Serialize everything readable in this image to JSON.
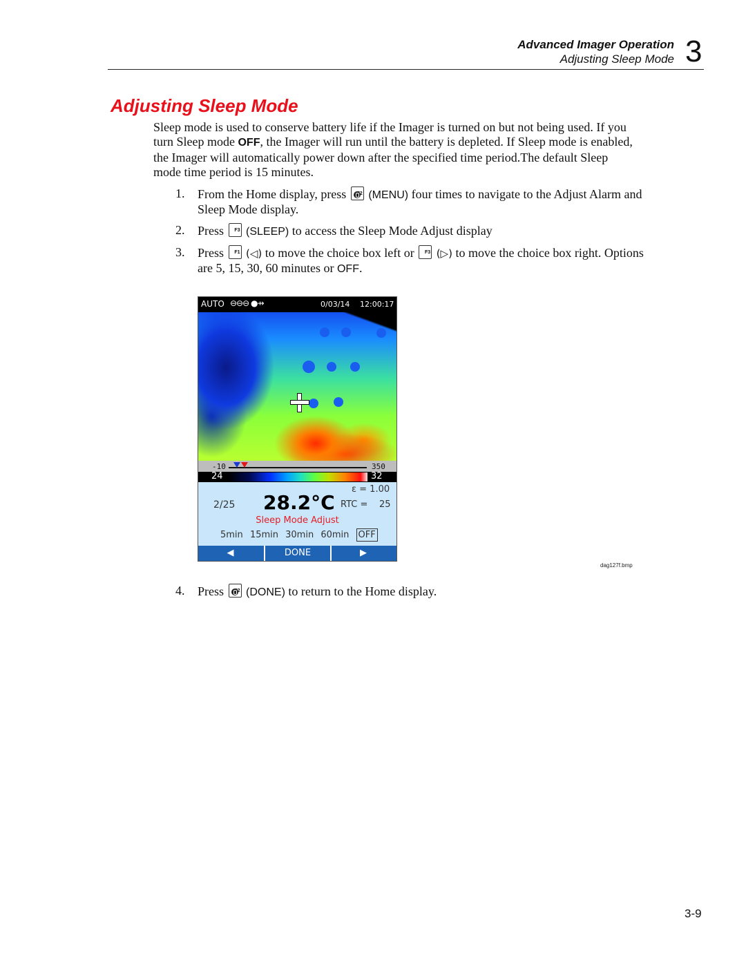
{
  "header": {
    "chapter_title": "Advanced Imager Operation",
    "section_title": "Adjusting Sleep Mode",
    "chapter_number": "3"
  },
  "section": {
    "title": "Adjusting Sleep Mode",
    "intro": {
      "part1": "Sleep mode is used to conserve battery life if the Imager is turned on but not being used. If you turn Sleep mode ",
      "bold": "OFF",
      "part2": ", the Imager will run until the battery is depleted. If Sleep mode is enabled, the Imager will automatically power down after the specified time period.The default Sleep mode time period is 15 minutes."
    }
  },
  "steps": [
    {
      "num": "1.",
      "a": "From the Home display, press ",
      "key": "F2",
      "b": " (MENU) four times to navigate to the Adjust Alarm and Sleep Mode display.",
      "key_label": "(MENU)"
    },
    {
      "num": "2.",
      "a": "Press ",
      "key": "F3",
      "key_label": "(SLEEP)",
      "b": " to access the Sleep Mode Adjust display"
    },
    {
      "num": "3.",
      "a": "Press ",
      "key1": "F1",
      "left": "(◁)",
      "mid": " to move the choice box left or ",
      "key2": "F3",
      "right": "(▷)",
      "b": " to move the choice box right. Options are 5, 15, 30, 60 minutes or ",
      "off": "OFF",
      "end": "."
    },
    {
      "num": "4.",
      "a": "Press ",
      "key": "F2",
      "key_label": "(DONE)",
      "b": " to return to the Home display."
    }
  ],
  "screen": {
    "mode": "AUTO",
    "status_icons": "⊖⊖⊖ ●⇸",
    "date": "0/03/14",
    "time": "12:00:17",
    "scale_low": "-10",
    "scale_high": "350",
    "palette_low": "24",
    "palette_high": "32",
    "emissivity": "ε = 1.00",
    "image_count": "2/25",
    "temperature": "28.2°C",
    "rtc_label": "RTC =",
    "rtc_value": "25",
    "menu_title": "Sleep Mode Adjust",
    "options": [
      "5min",
      "15min",
      "30min",
      "60min"
    ],
    "selected_option": "OFF",
    "softkeys": {
      "left": "◀",
      "center": "DONE",
      "right": "▶"
    },
    "colors": {
      "title": "#e81c24",
      "softkey_bar": "#1f63b4",
      "panel": "#c9e6fb"
    }
  },
  "figure_caption": "dag127f.bmp",
  "page_number": "3-9",
  "colors": {
    "heading": "#e8101a"
  }
}
